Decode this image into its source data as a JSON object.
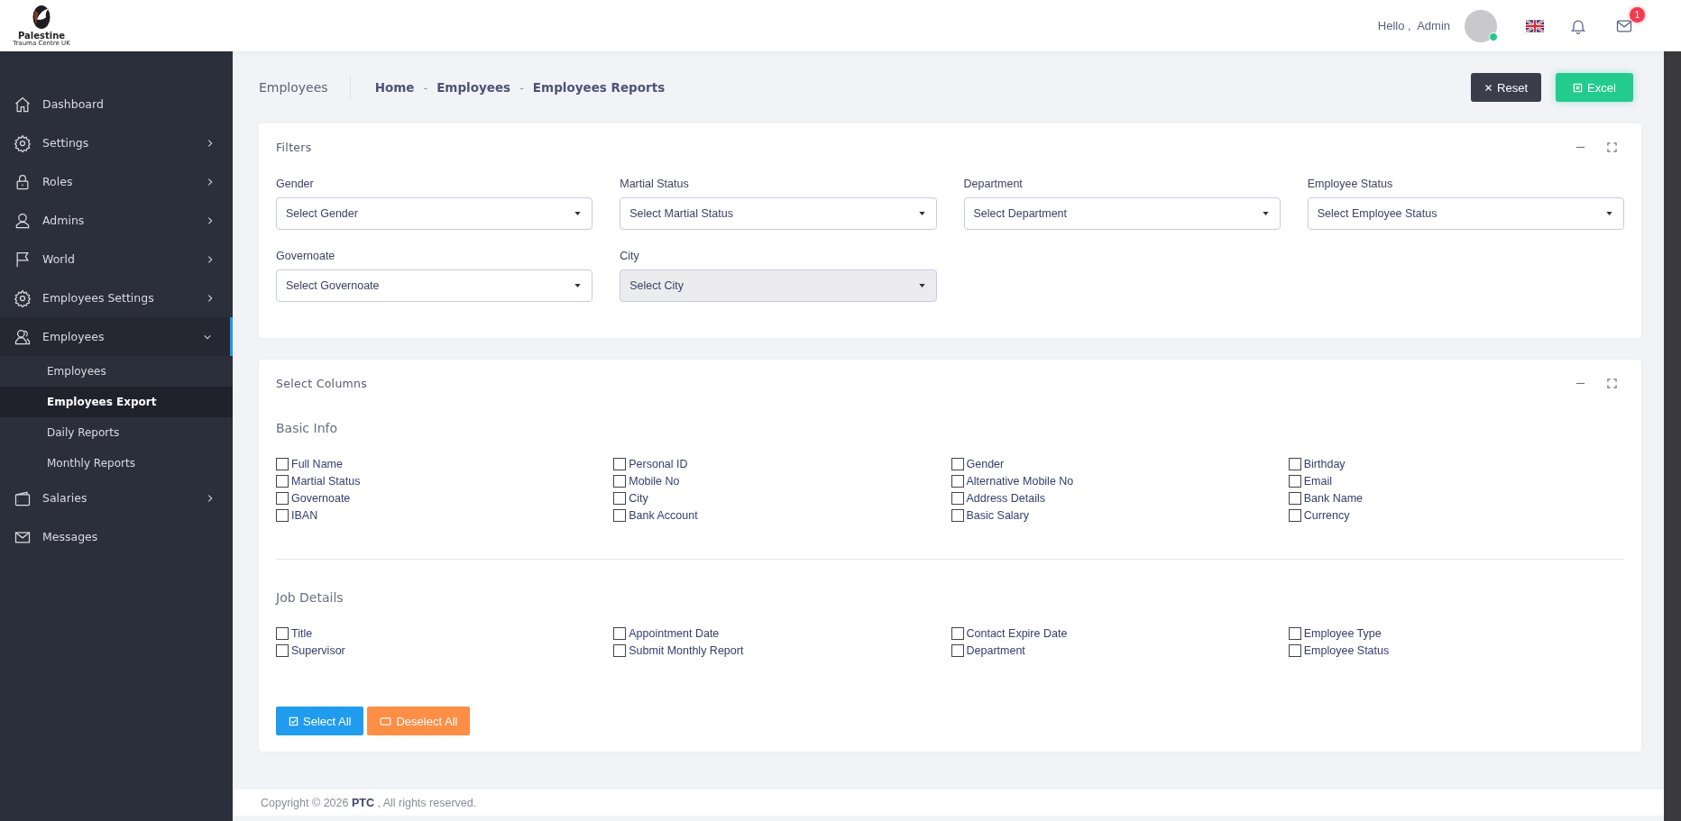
{
  "logo": {
    "name": "Palestine",
    "subtitle": "Trauma Centre UK"
  },
  "header": {
    "greeting": "Hello ,  Admin",
    "online": true,
    "mail_badge": "1"
  },
  "sidebar": {
    "items": [
      {
        "label": "Dashboard",
        "has_submenu": false,
        "selected": false
      },
      {
        "label": "Settings",
        "has_submenu": true,
        "expanded": false,
        "selected": false
      },
      {
        "label": "Roles",
        "has_submenu": true,
        "expanded": false,
        "selected": false
      },
      {
        "label": "Admins",
        "has_submenu": true,
        "expanded": false,
        "selected": false
      },
      {
        "label": "World",
        "has_submenu": true,
        "expanded": false,
        "selected": false
      },
      {
        "label": "Employees Settings",
        "has_submenu": true,
        "expanded": false,
        "selected": false
      },
      {
        "label": "Employees",
        "has_submenu": true,
        "expanded": true,
        "selected": true,
        "children": [
          {
            "label": "Employees",
            "selected": false
          },
          {
            "label": "Employees Export",
            "selected": true
          },
          {
            "label": "Daily Reports",
            "selected": false
          },
          {
            "label": "Monthly Reports",
            "selected": false
          }
        ]
      },
      {
        "label": "Salaries",
        "has_submenu": true,
        "expanded": false,
        "selected": false
      },
      {
        "label": "Messages",
        "has_submenu": false,
        "selected": false
      }
    ]
  },
  "page_title": "Employees",
  "breadcrumb": [
    "Home",
    "Employees",
    "Employees Reports"
  ],
  "separator": "-",
  "actions": [
    {
      "label": "Reset",
      "kind": "reset"
    },
    {
      "label": "Excel",
      "kind": "excel"
    }
  ],
  "filters": {
    "title": "Filters",
    "fields": [
      {
        "label": "Gender",
        "placeholder": "Select Gender",
        "disabled": false
      },
      {
        "label": "Martial Status",
        "placeholder": "Select Martial Status",
        "disabled": false
      },
      {
        "label": "Department",
        "placeholder": "Select Department",
        "disabled": false
      },
      {
        "label": "Employee Status",
        "placeholder": "Select Employee Status",
        "disabled": false
      },
      {
        "label": "Governoate",
        "placeholder": "Select Governoate",
        "disabled": false
      },
      {
        "label": "City",
        "placeholder": "Select City",
        "disabled": true
      }
    ]
  },
  "columns": {
    "title": "Select Columns",
    "groups": [
      {
        "title": "Basic Info",
        "options": [
          {
            "label": "Full Name",
            "checked": false
          },
          {
            "label": "Personal ID",
            "checked": false
          },
          {
            "label": "Gender",
            "checked": false
          },
          {
            "label": "Birthday",
            "checked": false
          },
          {
            "label": "Martial Status",
            "checked": false
          },
          {
            "label": "Mobile No",
            "checked": false
          },
          {
            "label": "Alternative Mobile No",
            "checked": false
          },
          {
            "label": "Email",
            "checked": false
          },
          {
            "label": "Governoate",
            "checked": false
          },
          {
            "label": "City",
            "checked": false
          },
          {
            "label": "Address Details",
            "checked": false
          },
          {
            "label": "Bank Name",
            "checked": false
          },
          {
            "label": "IBAN",
            "checked": false
          },
          {
            "label": "Bank Account",
            "checked": false
          },
          {
            "label": "Basic Salary",
            "checked": false
          },
          {
            "label": "Currency",
            "checked": false
          }
        ]
      },
      {
        "title": "Job Details",
        "options": [
          {
            "label": "Title",
            "checked": false
          },
          {
            "label": "Appointment Date",
            "checked": false
          },
          {
            "label": "Contact Expire Date",
            "checked": false
          },
          {
            "label": "Employee Type",
            "checked": false
          },
          {
            "label": "Supervisor",
            "checked": false
          },
          {
            "label": "Submit Monthly Report",
            "checked": false
          },
          {
            "label": "Department",
            "checked": false
          },
          {
            "label": "Employee Status",
            "checked": false
          }
        ]
      }
    ],
    "buttons": [
      {
        "label": "Select All",
        "kind": "select"
      },
      {
        "label": "Deselect All",
        "kind": "deselect"
      }
    ]
  },
  "footer": {
    "before": "Copyright © 2026",
    "brand": "PTC",
    "after": ", All rights reserved."
  }
}
